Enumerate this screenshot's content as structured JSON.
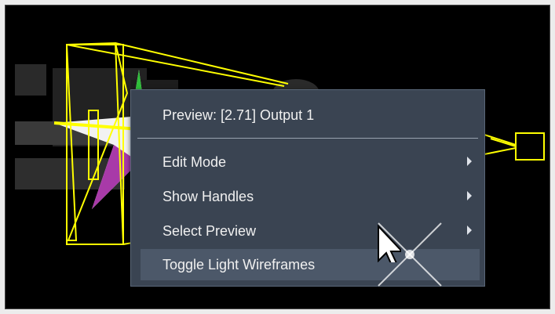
{
  "menu": {
    "title": "Preview: [2.71] Output 1",
    "items": [
      {
        "label": "Edit Mode",
        "submenu": true
      },
      {
        "label": "Show Handles",
        "submenu": true
      },
      {
        "label": "Select Preview",
        "submenu": true
      },
      {
        "label": "Toggle Light Wireframes",
        "submenu": false,
        "highlighted": true
      }
    ]
  },
  "icons": {
    "submenu_arrow": "chevron-right-icon",
    "cursor": "mouse-pointer-icon",
    "sparkle": "sparkle-highlight-icon"
  },
  "colors": {
    "wireframe": "#ffff00",
    "menu_bg": "#3a4452",
    "menu_hover": "#4c5869",
    "viewport_bg": "#000000"
  }
}
